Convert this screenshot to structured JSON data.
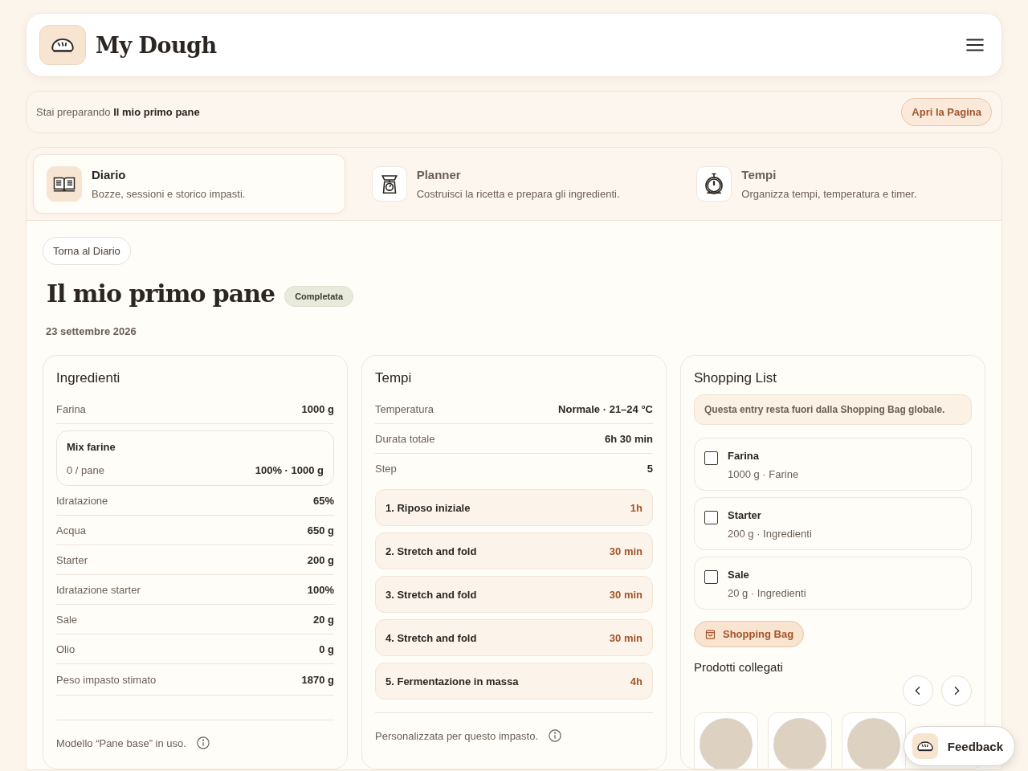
{
  "header": {
    "title": "My Dough"
  },
  "banner": {
    "text": "Stai preparando **Il mio primo pane**",
    "button": "Apri la Pagina"
  },
  "tabs": [
    {
      "kind": "book",
      "title": "Diario",
      "description": "Bozze, sessioni e storico impasti.",
      "selected": true
    },
    {
      "kind": "scale",
      "title": "Planner",
      "description": "Costruisci la ricetta e prepara gli ingredienti.",
      "selected": false
    },
    {
      "kind": "stopwatch",
      "title": "Tempi",
      "description": "Organizza tempi, temperatura e timer.",
      "selected": false
    }
  ],
  "back_button": "Torna al Diario",
  "dough": {
    "title": "Il mio primo pane",
    "status": "Completata",
    "date": "23 settembre 2026"
  },
  "ingredients": {
    "title": "Ingredienti",
    "rows": [
      {
        "kind": "row",
        "label": "Farina",
        "value": "1000 g"
      },
      {
        "kind": "mix",
        "title": "Mix farine",
        "label": "0 / pane",
        "value": "100% · 1000 g"
      },
      {
        "kind": "row",
        "label": "Idratazione",
        "value": "65%"
      },
      {
        "kind": "row",
        "label": "Acqua",
        "value": "650 g"
      },
      {
        "kind": "row",
        "label": "Starter",
        "value": "200 g"
      },
      {
        "kind": "row",
        "label": "Idratazione starter",
        "value": "100%"
      },
      {
        "kind": "row",
        "label": "Sale",
        "value": "20 g"
      },
      {
        "kind": "row",
        "label": "Olio",
        "value": "0 g"
      },
      {
        "kind": "row",
        "label": "Peso impasto stimato",
        "value": "1870 g"
      }
    ],
    "note": "Modello “Pane base” in uso."
  },
  "timing": {
    "title": "Tempi",
    "rows": [
      {
        "label": "Temperatura",
        "value": "Normale · 21–24 °C"
      },
      {
        "label": "Durata totale",
        "value": "6h 30 min"
      },
      {
        "label": "Step",
        "value": "5"
      }
    ],
    "steps": [
      {
        "label": "1. Riposo iniziale",
        "duration": "1h"
      },
      {
        "label": "2. Stretch and fold",
        "duration": "30 min"
      },
      {
        "label": "3. Stretch and fold",
        "duration": "30 min"
      },
      {
        "label": "4. Stretch and fold",
        "duration": "30 min"
      },
      {
        "label": "5. Fermentazione in massa",
        "duration": "4h"
      }
    ],
    "note": "Personalizzata per questo impasto."
  },
  "shopping": {
    "title": "Shopping List",
    "notice": "Questa entry resta fuori dalla Shopping Bag globale.",
    "items": [
      {
        "name": "Farina",
        "detail": "1000 g · Farine",
        "checked": false
      },
      {
        "name": "Starter",
        "detail": "200 g · Ingredienti",
        "checked": false
      },
      {
        "name": "Sale",
        "detail": "20 g · Ingredienti",
        "checked": false
      }
    ],
    "button": "Shopping Bag",
    "products_title": "Prodotti collegati"
  },
  "feedback": {
    "label": "Feedback"
  }
}
